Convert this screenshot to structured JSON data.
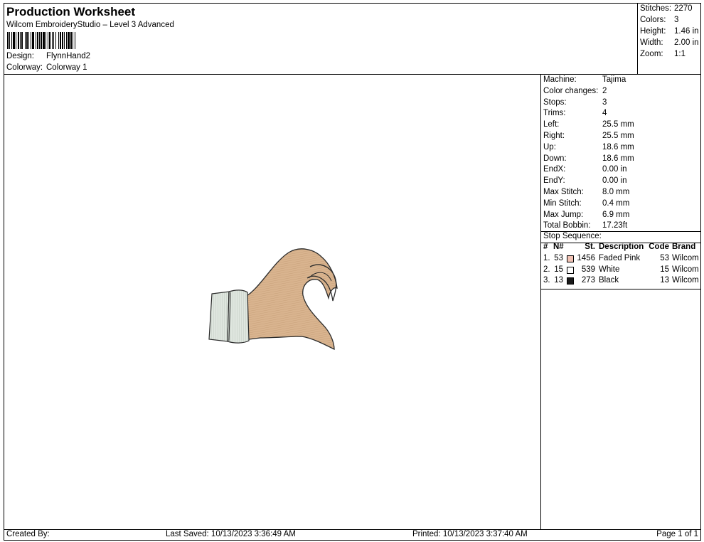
{
  "header": {
    "title": "Production Worksheet",
    "subtitle": "Wilcom EmbroideryStudio – Level 3 Advanced",
    "design_label": "Design:",
    "design_value": "FlynnHand2",
    "colorway_label": "Colorway:",
    "colorway_value": "Colorway 1"
  },
  "stats": {
    "stitches_label": "Stitches:",
    "stitches_value": "2270",
    "colors_label": "Colors:",
    "colors_value": "3",
    "height_label": "Height:",
    "height_value": "1.46 in",
    "width_label": "Width:",
    "width_value": "2.00 in",
    "zoom_label": "Zoom:",
    "zoom_value": "1:1"
  },
  "specs": [
    {
      "label": "Machine:",
      "value": "Tajima"
    },
    {
      "label": "Color changes:",
      "value": "2"
    },
    {
      "label": "Stops:",
      "value": "3"
    },
    {
      "label": "Trims:",
      "value": "4"
    },
    {
      "label": "Left:",
      "value": "25.5 mm"
    },
    {
      "label": "Right:",
      "value": "25.5 mm"
    },
    {
      "label": "Up:",
      "value": "18.6 mm"
    },
    {
      "label": "Down:",
      "value": "18.6 mm"
    },
    {
      "label": "EndX:",
      "value": "0.00 in"
    },
    {
      "label": "EndY:",
      "value": "0.00 in"
    },
    {
      "label": "Max Stitch:",
      "value": "8.0 mm"
    },
    {
      "label": "Min Stitch:",
      "value": "0.4 mm"
    },
    {
      "label": "Max Jump:",
      "value": "6.9 mm"
    },
    {
      "label": "Total Bobbin:",
      "value": "17.23ft"
    }
  ],
  "stop_sequence": {
    "title": "Stop Sequence:",
    "headers": {
      "idx": "#",
      "n": "N#",
      "st": "St.",
      "desc": "Description",
      "code": "Code",
      "brand": "Brand"
    },
    "rows": [
      {
        "idx": "1.",
        "n": "53",
        "color": "#f2c3b5",
        "st": "1456",
        "desc": "Faded Pink",
        "code": "53",
        "brand": "Wilcom"
      },
      {
        "idx": "2.",
        "n": "15",
        "color": "#ffffff",
        "st": "539",
        "desc": "White",
        "code": "15",
        "brand": "Wilcom"
      },
      {
        "idx": "3.",
        "n": "13",
        "color": "#1a1a1a",
        "st": "273",
        "desc": "Black",
        "code": "13",
        "brand": "Wilcom"
      }
    ]
  },
  "footer": {
    "created_by": "Created By:",
    "last_saved": "Last Saved: 10/13/2023 3:36:49 AM",
    "printed": "Printed: 10/13/2023 3:37:40 AM",
    "page": "Page 1 of 1"
  },
  "design_colors": {
    "skin": "#d9b48f",
    "cuff": "#dfe6df",
    "outline": "#2b2b2b"
  }
}
